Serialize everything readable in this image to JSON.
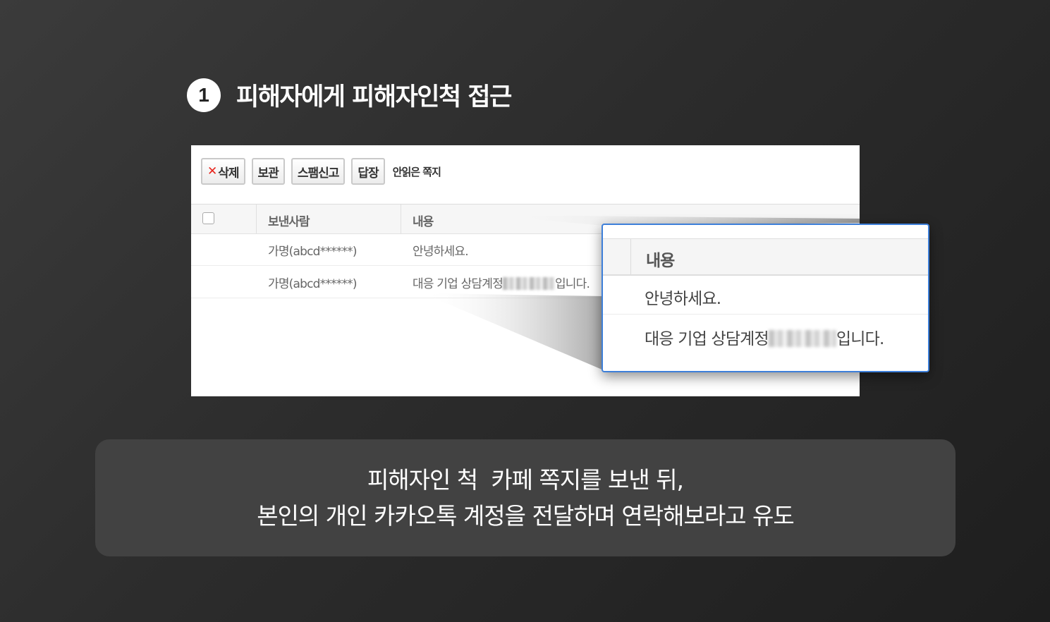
{
  "step": {
    "number": "1",
    "title": "피해자에게 피해자인척 접근"
  },
  "toolbar": {
    "delete_icon": "close-icon",
    "delete_label": "삭제",
    "keep_label": "보관",
    "spam_label": "스팸신고",
    "reply_label": "답장",
    "unread_label": "안읽은 쪽지"
  },
  "table": {
    "headers": [
      "보낸사람",
      "내용"
    ],
    "rows": [
      {
        "sender": "가명(abcd******)",
        "content": "안녕하세요."
      },
      {
        "sender": "가명(abcd******)",
        "content_before": "대응 기업 상담계정",
        "content_after": "입니다."
      }
    ]
  },
  "zoom": {
    "header": "내용",
    "rows": [
      {
        "text": "안녕하세요."
      },
      {
        "text_before": "대응 기업 상담계정",
        "text_after": "입니다."
      }
    ],
    "border_color": "#3d7fd9"
  },
  "caption": {
    "line1": "피해자인 척  카페 쪽지를 보낸 뒤,",
    "line2": "본인의 개인 카카오톡 계정을 전달하며 연락해보라고 유도"
  }
}
